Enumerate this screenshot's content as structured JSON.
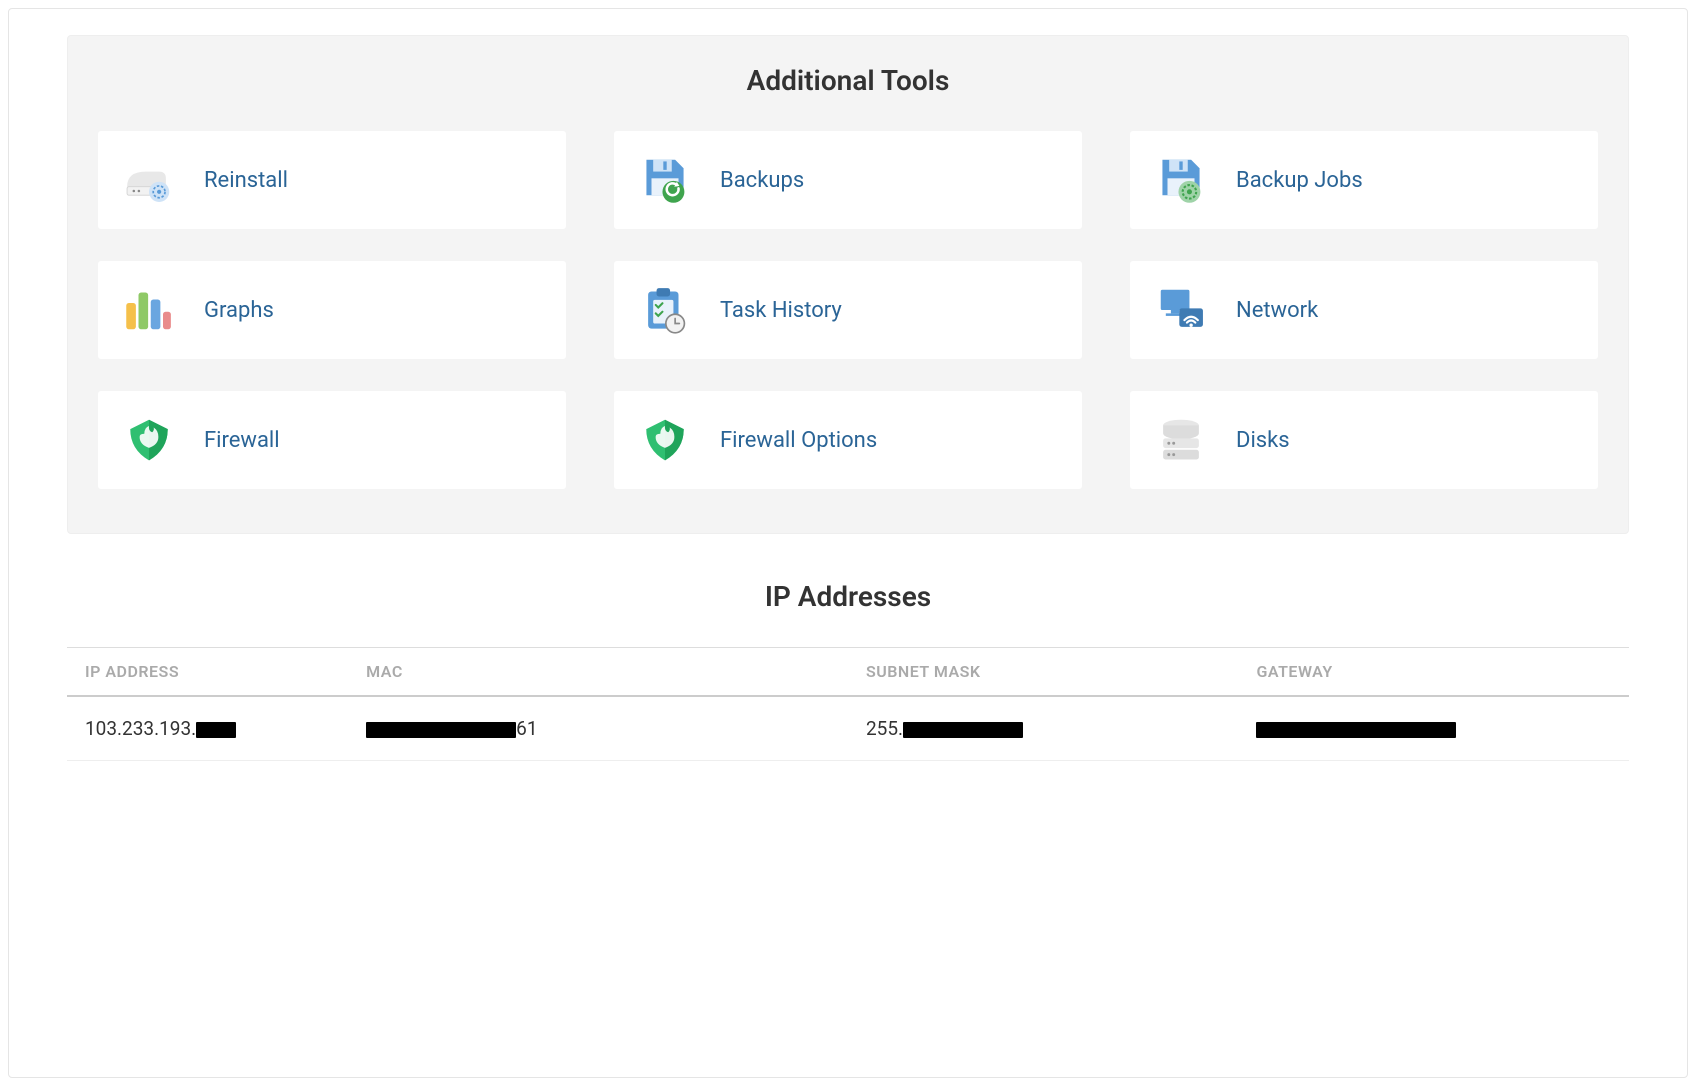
{
  "tools": {
    "title": "Additional Tools",
    "items": [
      {
        "label": "Reinstall",
        "icon": "reinstall-icon"
      },
      {
        "label": "Backups",
        "icon": "backups-icon"
      },
      {
        "label": "Backup Jobs",
        "icon": "backup-jobs-icon"
      },
      {
        "label": "Graphs",
        "icon": "graphs-icon"
      },
      {
        "label": "Task History",
        "icon": "task-history-icon"
      },
      {
        "label": "Network",
        "icon": "network-icon"
      },
      {
        "label": "Firewall",
        "icon": "firewall-icon"
      },
      {
        "label": "Firewall Options",
        "icon": "firewall-options-icon"
      },
      {
        "label": "Disks",
        "icon": "disks-icon"
      }
    ]
  },
  "ip_section": {
    "title": "IP Addresses",
    "columns": [
      "IP ADDRESS",
      "MAC",
      "SUBNET MASK",
      "GATEWAY"
    ],
    "rows": [
      {
        "ip_prefix": "103.233.193.",
        "mac_suffix": "61",
        "mask_prefix": "255."
      }
    ]
  }
}
